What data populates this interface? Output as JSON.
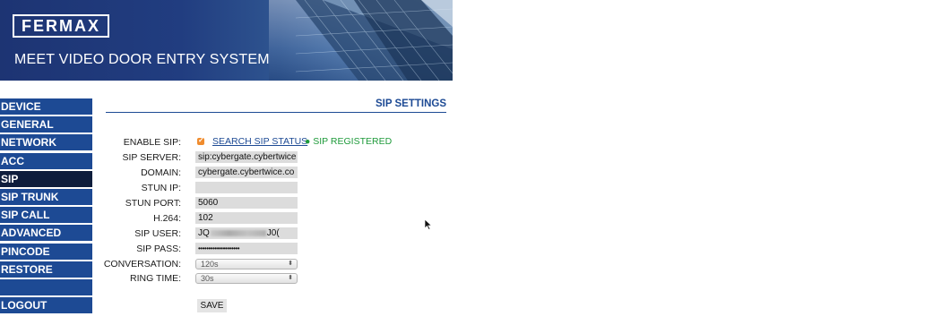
{
  "header": {
    "logo_text": "FERMAX",
    "tagline": "MEET VIDEO DOOR ENTRY SYSTEM"
  },
  "menu": {
    "items": [
      {
        "label": "DEVICE"
      },
      {
        "label": "GENERAL"
      },
      {
        "label": "NETWORK"
      },
      {
        "label": "ACC"
      },
      {
        "label": "SIP"
      },
      {
        "label": "SIP TRUNK"
      },
      {
        "label": "SIP CALL"
      },
      {
        "label": "ADVANCED"
      },
      {
        "label": "PINCODE"
      },
      {
        "label": "RESTORE"
      }
    ],
    "active": "SIP",
    "logout_label": "LOGOUT"
  },
  "section": {
    "title": "SIP SETTINGS"
  },
  "form": {
    "enable_sip": {
      "label": "ENABLE SIP:",
      "checked": true
    },
    "search_status_link": "SEARCH SIP STATUS",
    "registration_status": "● SIP REGISTERED",
    "sip_server": {
      "label": "SIP SERVER:",
      "value": "sip:cybergate.cybertwice"
    },
    "domain": {
      "label": "DOMAIN:",
      "value": "cybergate.cybertwice.co"
    },
    "stun_ip": {
      "label": "STUN IP:",
      "value": ""
    },
    "stun_port": {
      "label": "STUN PORT:",
      "value": "5060"
    },
    "h264": {
      "label": "H.264:",
      "value": "102"
    },
    "sip_user": {
      "label": "SIP USER:",
      "value_prefix": "JQ",
      "value_suffix": "J0("
    },
    "sip_pass": {
      "label": "SIP PASS:",
      "value": "••••••••••••••••••••"
    },
    "conversation": {
      "label": "CONVERSATION:",
      "value": "120s"
    },
    "ring_time": {
      "label": "RING TIME:",
      "value": "30s"
    },
    "save_label": "SAVE"
  },
  "colors": {
    "menu_bg": "#1d4a94",
    "menu_active_bg": "#0e1d3c",
    "accent": "#1d4a94",
    "registered": "#1e9a3a",
    "checkbox": "#f08c2e"
  },
  "icons": {
    "checkbox": "check-icon",
    "select_arrows": "updown-arrows-icon",
    "cursor": "mouse-pointer-icon"
  }
}
